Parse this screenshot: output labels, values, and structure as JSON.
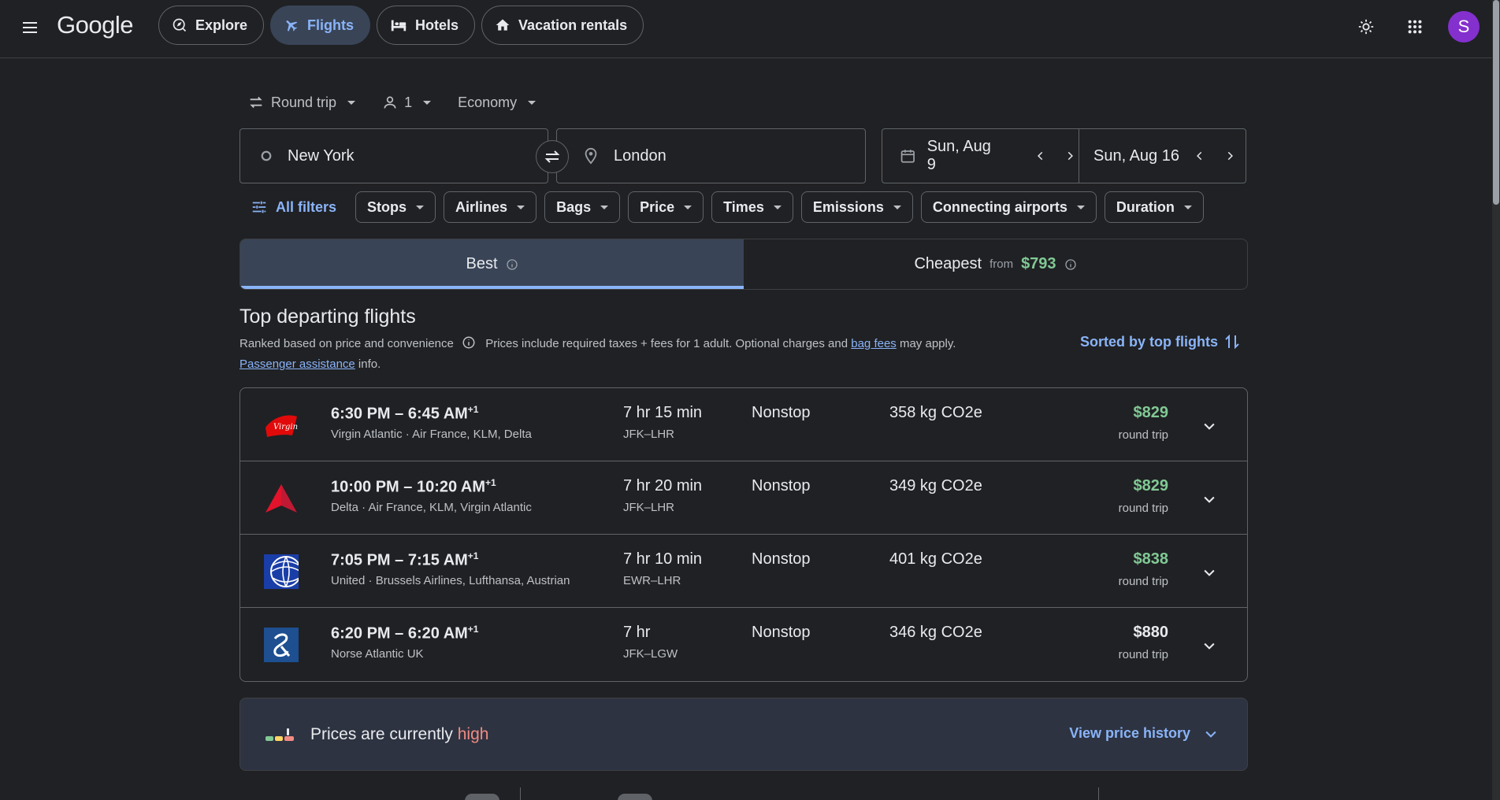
{
  "header": {
    "logo": "Google",
    "tabs": [
      {
        "label": "Explore",
        "icon": "explore-icon"
      },
      {
        "label": "Flights",
        "icon": "flight-icon",
        "active": true
      },
      {
        "label": "Hotels",
        "icon": "hotel-icon"
      },
      {
        "label": "Vacation rentals",
        "icon": "home-icon"
      }
    ],
    "avatar_letter": "S"
  },
  "search": {
    "trip_type": "Round trip",
    "passengers": "1",
    "cabin": "Economy",
    "from": "New York",
    "to": "London",
    "depart_date": "Sun, Aug 9",
    "return_date": "Sun, Aug 16"
  },
  "filters": {
    "all_filters_label": "All filters",
    "chips": [
      "Stops",
      "Airlines",
      "Bags",
      "Price",
      "Times",
      "Emissions",
      "Connecting airports",
      "Duration"
    ]
  },
  "sort_tabs": {
    "best_label": "Best",
    "cheapest_label": "Cheapest",
    "cheapest_from_label": "from",
    "cheapest_price": "$793"
  },
  "results": {
    "title": "Top departing flights",
    "ranked_text": "Ranked based on price and convenience",
    "prices_text": "Prices include required taxes + fees for 1 adult. Optional charges and",
    "bag_fees_link": "bag fees",
    "may_apply_text": "may apply.",
    "passenger_link": "Passenger assistance",
    "info_text": "info.",
    "sorted_label": "Sorted by top flights",
    "flights": [
      {
        "depart": "6:30 PM",
        "arrive": "6:45 AM",
        "day_offset": "+1",
        "airlines": "Virgin Atlantic · Air France, KLM, Delta",
        "duration": "7 hr 15 min",
        "route": "JFK–LHR",
        "stops": "Nonstop",
        "emissions": "358 kg CO2e",
        "price": "$829",
        "price_type": "round trip",
        "logo": "virgin-atlantic-logo",
        "price_color": "#81c995"
      },
      {
        "depart": "10:00 PM",
        "arrive": "10:20 AM",
        "day_offset": "+1",
        "airlines": "Delta · Air France, KLM, Virgin Atlantic",
        "duration": "7 hr 20 min",
        "route": "JFK–LHR",
        "stops": "Nonstop",
        "emissions": "349 kg CO2e",
        "price": "$829",
        "price_type": "round trip",
        "logo": "delta-logo",
        "price_color": "#81c995"
      },
      {
        "depart": "7:05 PM",
        "arrive": "7:15 AM",
        "day_offset": "+1",
        "airlines": "United · Brussels Airlines, Lufthansa, Austrian",
        "duration": "7 hr 10 min",
        "route": "EWR–LHR",
        "stops": "Nonstop",
        "emissions": "401 kg CO2e",
        "price": "$838",
        "price_type": "round trip",
        "logo": "united-logo",
        "price_color": "#81c995"
      },
      {
        "depart": "6:20 PM",
        "arrive": "6:20 AM",
        "day_offset": "+1",
        "airlines": "Norse Atlantic UK",
        "duration": "7 hr",
        "route": "JFK–LGW",
        "stops": "Nonstop",
        "emissions": "346 kg CO2e",
        "price": "$880",
        "price_type": "round trip",
        "logo": "norse-atlantic-logo",
        "price_color": "#e8eaed"
      }
    ]
  },
  "price_insight": {
    "text": "Prices are currently",
    "level": "high",
    "link": "View price history"
  },
  "colors": {
    "accent": "#8ab4f8",
    "good_price": "#81c995",
    "high": "#f28b82",
    "background": "#202124"
  }
}
